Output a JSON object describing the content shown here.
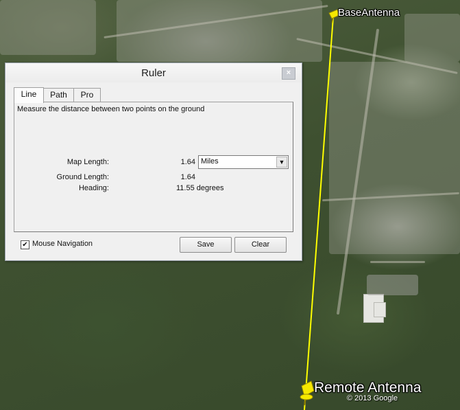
{
  "map": {
    "base_pin_label": "BaseAntenna",
    "remote_pin_label": "Remote Antenna",
    "copyright": "© 2013 Google",
    "line_color": "#ffff00",
    "pin_color": "#f5e800"
  },
  "dialog": {
    "title": "Ruler",
    "close_glyph": "×",
    "tabs": [
      {
        "label": "Line",
        "active": true
      },
      {
        "label": "Path",
        "active": false
      },
      {
        "label": "Pro",
        "active": false
      }
    ],
    "description": "Measure the distance between two points on the ground",
    "map_length_label": "Map Length:",
    "map_length_value": "1.64",
    "units_selected": "Miles",
    "ground_length_label": "Ground Length:",
    "ground_length_value": "1.64",
    "heading_label": "Heading:",
    "heading_value": "11.55 degrees",
    "mouse_navigation_label": "Mouse Navigation",
    "mouse_navigation_checked": true,
    "save_label": "Save",
    "clear_label": "Clear"
  }
}
